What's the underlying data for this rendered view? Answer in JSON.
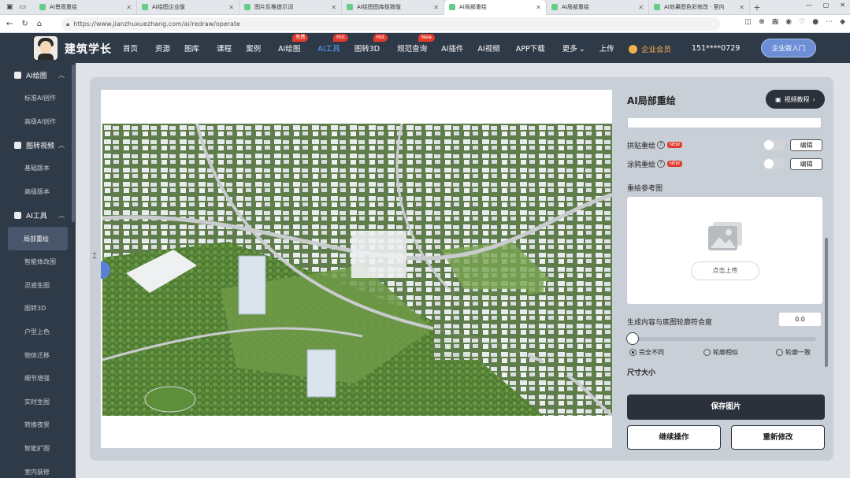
{
  "browser": {
    "tabs": [
      {
        "label": "AI景观重绘",
        "active": false
      },
      {
        "label": "AI绘图企业版",
        "active": false
      },
      {
        "label": "图片反推提示词",
        "active": false
      },
      {
        "label": "AI绘图图库极致版",
        "active": false
      },
      {
        "label": "AI局部重绘",
        "active": true
      },
      {
        "label": "AI局部重绘",
        "active": false
      },
      {
        "label": "AI效果图色彩修改 · 室内",
        "active": false
      }
    ],
    "url": "https://www.jianzhuxuezhang.com/ai/redraw/operate"
  },
  "site": {
    "brand": "建筑学长",
    "nav": [
      {
        "label": "首页",
        "badge": "",
        "active": false
      },
      {
        "label": "资源",
        "badge": "",
        "active": false
      },
      {
        "label": "图库",
        "badge": "",
        "active": false
      },
      {
        "label": "课程",
        "badge": "",
        "active": false
      },
      {
        "label": "案例",
        "badge": "",
        "active": false
      },
      {
        "label": "AI绘图",
        "badge": "免费",
        "active": false
      },
      {
        "label": "AI工具",
        "badge": "Hot",
        "active": true
      },
      {
        "label": "图转3D",
        "badge": "Hot",
        "active": false
      },
      {
        "label": "规范查询",
        "badge": "New",
        "active": false
      },
      {
        "label": "AI插件",
        "badge": "",
        "active": false
      },
      {
        "label": "AI视频",
        "badge": "",
        "active": false
      },
      {
        "label": "APP下载",
        "badge": "",
        "active": false
      },
      {
        "label": "更多",
        "badge": "",
        "active": false
      },
      {
        "label": "上传",
        "badge": "",
        "active": false
      }
    ],
    "more_chevron": "⌄",
    "vip": "企业会员",
    "phone": "151****0729",
    "enterprise_btn": "企业版入门"
  },
  "sidebar": {
    "groups": [
      {
        "label": "AI绘图",
        "items": [
          "标准AI创作",
          "高级AI创作"
        ]
      },
      {
        "label": "图转视频",
        "items": [
          "基础版本",
          "高级版本"
        ]
      },
      {
        "label": "AI工具",
        "items": [
          "局部重绘",
          "智能体改图",
          "灵感生图",
          "图转3D",
          "户型上色",
          "物体迁移",
          "细节增强",
          "实时生图",
          "转换夜景",
          "智能扩图",
          "室内装修"
        ]
      }
    ],
    "active_item": "局部重绘"
  },
  "panel": {
    "title": "AI局部重绘",
    "video_btn": "视频教程",
    "paste_redraw": "拼贴重绘",
    "graffiti_redraw": "涂鸦重绘",
    "new_badge": "NEW",
    "edit_label": "编辑",
    "ref_label": "重绘参考图",
    "upload_btn": "点击上传",
    "fit_label": "生成内容与底图轮廓符合度",
    "fit_value": "0.0",
    "slider_value": 0,
    "radios": [
      {
        "label": "完全不同",
        "checked": true
      },
      {
        "label": "轮廓相似",
        "checked": false
      },
      {
        "label": "轮廓一致",
        "checked": false
      }
    ],
    "size_label": "尺寸大小",
    "save_btn": "保存图片",
    "continue_btn": "继续操作",
    "redo_btn": "重新修改"
  },
  "colors": {
    "header_bg": "#2f3a48",
    "nav_active": "#5aa0ff",
    "hot_badge": "#e23b2e",
    "vip_gold": "#f3b04b",
    "primary_dark": "#2b313b"
  }
}
